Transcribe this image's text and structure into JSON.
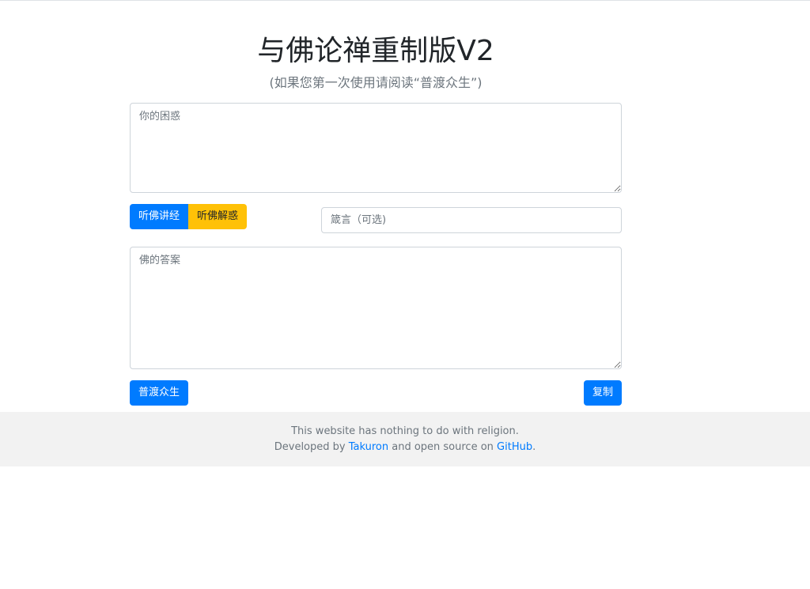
{
  "header": {
    "title": "与佛论禅重制版V2",
    "subtitle": "(如果您第一次使用请阅读“普渡众生”)"
  },
  "question": {
    "placeholder": "你的困惑",
    "value": ""
  },
  "actions": {
    "encode_label": "听佛讲经",
    "decode_label": "听佛解惑"
  },
  "motto": {
    "placeholder": "箴言（可选)",
    "value": ""
  },
  "answer": {
    "placeholder": "佛的答案",
    "value": ""
  },
  "bottom_buttons": {
    "help_label": "普渡众生",
    "copy_label": "复制"
  },
  "footer": {
    "line1": "This website has nothing to do with religion.",
    "line2_prefix": "Developed by ",
    "author_link": "Takuron",
    "line2_middle": " and open source on ",
    "github_link": "GitHub",
    "line2_suffix": "."
  },
  "colors": {
    "primary": "#007bff",
    "warning": "#ffc107",
    "footer_bg": "#f2f2f2"
  }
}
